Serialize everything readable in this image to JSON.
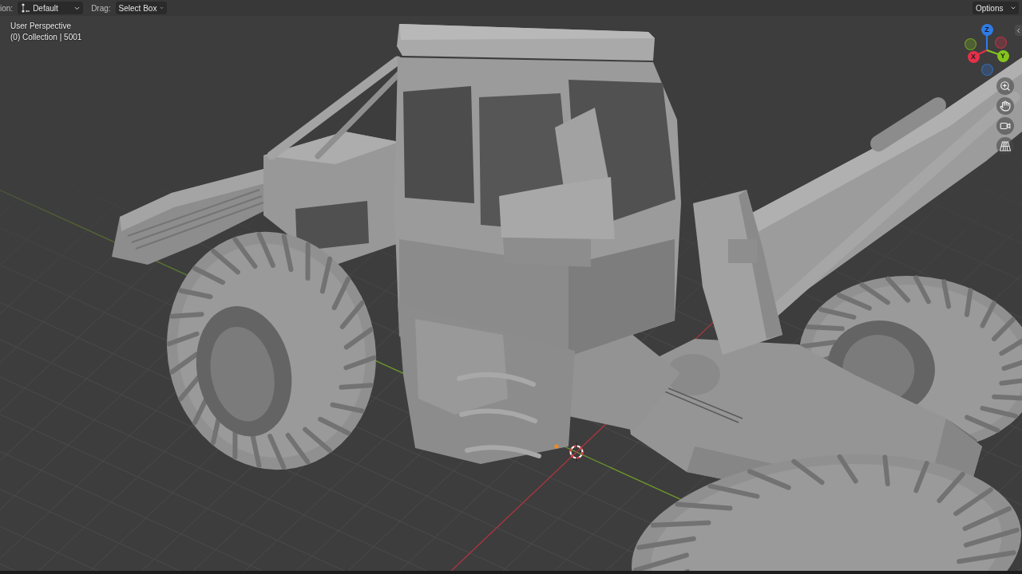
{
  "header": {
    "orientation": {
      "label": "ion:",
      "value": "Default"
    },
    "drag": {
      "label": "Drag:",
      "value": "Select Box"
    },
    "options": {
      "label": "Options"
    }
  },
  "viewport": {
    "view_name": "User Perspective",
    "scene_info": "(0) Collection | 5001"
  },
  "gizmo": {
    "axes": [
      {
        "label": "Z",
        "color": "#2f7be6"
      },
      {
        "label": "X",
        "color": "#e5304a"
      },
      {
        "label": "Y",
        "color": "#84c41c"
      }
    ]
  }
}
